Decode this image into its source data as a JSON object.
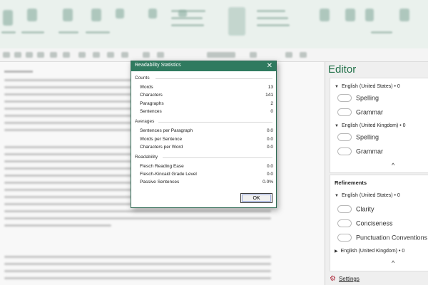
{
  "dialog": {
    "title": "Readability Statistics",
    "close_symbol": "✕",
    "sections": [
      {
        "label": "Counts",
        "rows": [
          {
            "label": "Words",
            "value": "13"
          },
          {
            "label": "Characters",
            "value": "141"
          },
          {
            "label": "Paragraphs",
            "value": "2"
          },
          {
            "label": "Sentences",
            "value": "0"
          }
        ]
      },
      {
        "label": "Averages",
        "rows": [
          {
            "label": "Sentences per Paragraph",
            "value": "0.0"
          },
          {
            "label": "Words per Sentence",
            "value": "0.0"
          },
          {
            "label": "Characters per Word",
            "value": "0.0"
          }
        ]
      },
      {
        "label": "Readability",
        "rows": [
          {
            "label": "Flesch Reading Ease",
            "value": "0.0"
          },
          {
            "label": "Flesch-Kincaid Grade Level",
            "value": "0.0"
          },
          {
            "label": "Passive Sentences",
            "value": "0.0%"
          }
        ]
      }
    ],
    "ok_label": "OK"
  },
  "editor": {
    "title": "Editor",
    "corrections": {
      "groups": [
        {
          "language": "English (United States) • 0",
          "options": [
            "Spelling",
            "Grammar"
          ]
        },
        {
          "language": "English (United Kingdom) • 0",
          "options": [
            "Spelling",
            "Grammar"
          ]
        }
      ],
      "collapse_symbol": "^"
    },
    "refinements": {
      "title": "Refinements",
      "language_us": "English (United States) • 0",
      "options": [
        "Clarity",
        "Conciseness",
        "Punctuation Conventions"
      ],
      "language_uk": "English (United Kingdom) • 0",
      "collapse_symbol": "^"
    },
    "settings_label": "Settings"
  },
  "colors": {
    "accent": "#2f7a5f",
    "editor_title": "#207048",
    "settings_gear": "#b03040"
  }
}
